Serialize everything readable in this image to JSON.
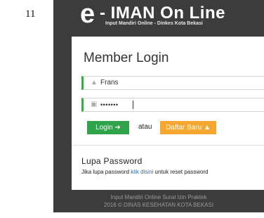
{
  "page_number": "11",
  "header": {
    "logo_e": "e",
    "title": "- IMAN On Line",
    "subtitle": "Input Mandiri Online - Dinkes Kota Bekasi"
  },
  "login": {
    "title": "Member Login",
    "username_icon": "user-icon",
    "username_value": "Frans",
    "password_icon": "lock-icon",
    "password_value": "•••••••",
    "login_button": "Login",
    "login_icon": "sign-in-icon",
    "or_text": "atau",
    "register_button": "Daftar Baru",
    "register_icon": "user-icon"
  },
  "forgot": {
    "title": "Lupa Password",
    "text_before": "Jika lupa password",
    "link_text": "klik disini",
    "text_after": "untuk reset password"
  },
  "footer": {
    "line1": "Input Mandiri Online Surat Izin Praktek",
    "line2": "2016 © DINAS KESEHATAN KOTA BEKASI"
  },
  "colors": {
    "frame_bg": "#3c3c3c",
    "accent_green": "#2ea34a",
    "accent_orange": "#f5a72f",
    "link_blue": "#2c6db8"
  }
}
